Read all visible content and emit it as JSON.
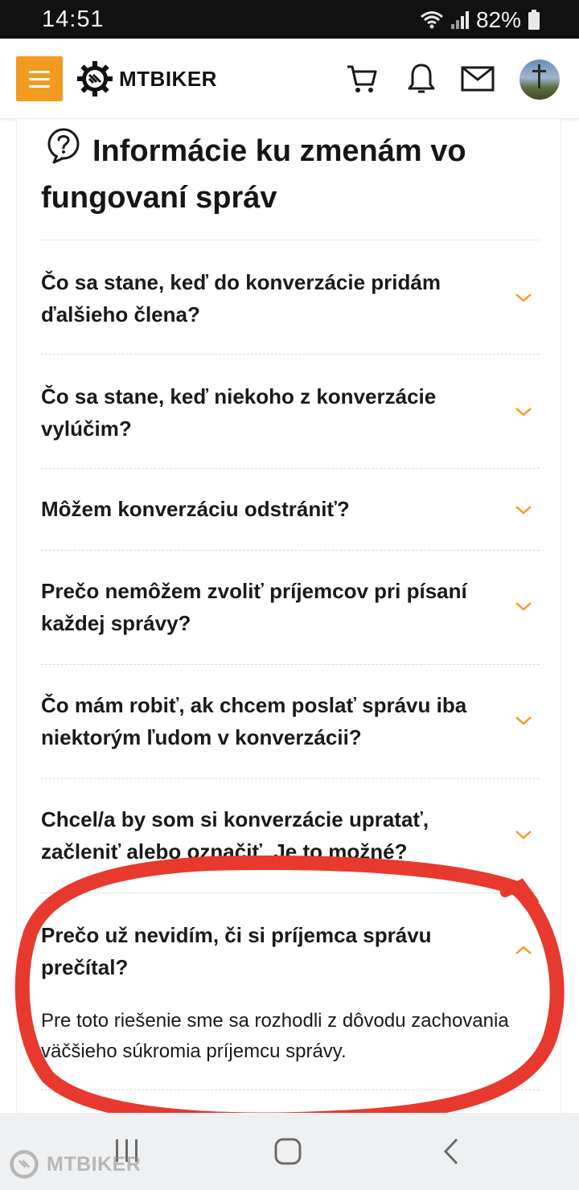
{
  "status_bar": {
    "time": "14:51",
    "battery": "82%",
    "icons": [
      "wifi-icon",
      "signal-icon",
      "battery-icon"
    ]
  },
  "header": {
    "brand": "MTBIKER",
    "icons": [
      "menu-icon",
      "gear-logo-icon",
      "cart-icon",
      "bell-icon",
      "mail-icon",
      "avatar"
    ],
    "accent_color": "#f39a21"
  },
  "page": {
    "title": "Informácie ku zmenám vo fungovaní správ",
    "title_icon": "question-bubble-icon"
  },
  "faq": [
    {
      "question": "Čo sa stane, keď do konverzácie pridám ďalšieho člena?",
      "answer": ""
    },
    {
      "question": "Čo sa stane, keď niekoho z konverzácie vylúčim?",
      "answer": ""
    },
    {
      "question": "Môžem konverzáciu odstrániť?",
      "answer": ""
    },
    {
      "question": "Prečo nemôžem zvoliť príjemcov pri písaní každej správy?",
      "answer": ""
    },
    {
      "question": "Čo mám robiť, ak chcem poslať správu iba niektorým ľudom v konverzácii?",
      "answer": ""
    },
    {
      "question": "Chcel/a by som si konverzácie upratať, začleniť alebo označiť. Je to možné?",
      "answer": ""
    },
    {
      "question": "Prečo už nevidím, či si príjemca správu prečítal?",
      "answer": "Pre toto riešenie sme sa rozhodli z dôvodu zachovania väčšieho súkromia príjemcu správy."
    }
  ],
  "annotation": {
    "color": "#e8392f",
    "shape": "hand-drawn ellipse around last FAQ item"
  },
  "watermark": {
    "text": "MTBIKER"
  },
  "nav_bar": {
    "icons": [
      "recent-apps-icon",
      "home-icon",
      "back-icon"
    ]
  }
}
